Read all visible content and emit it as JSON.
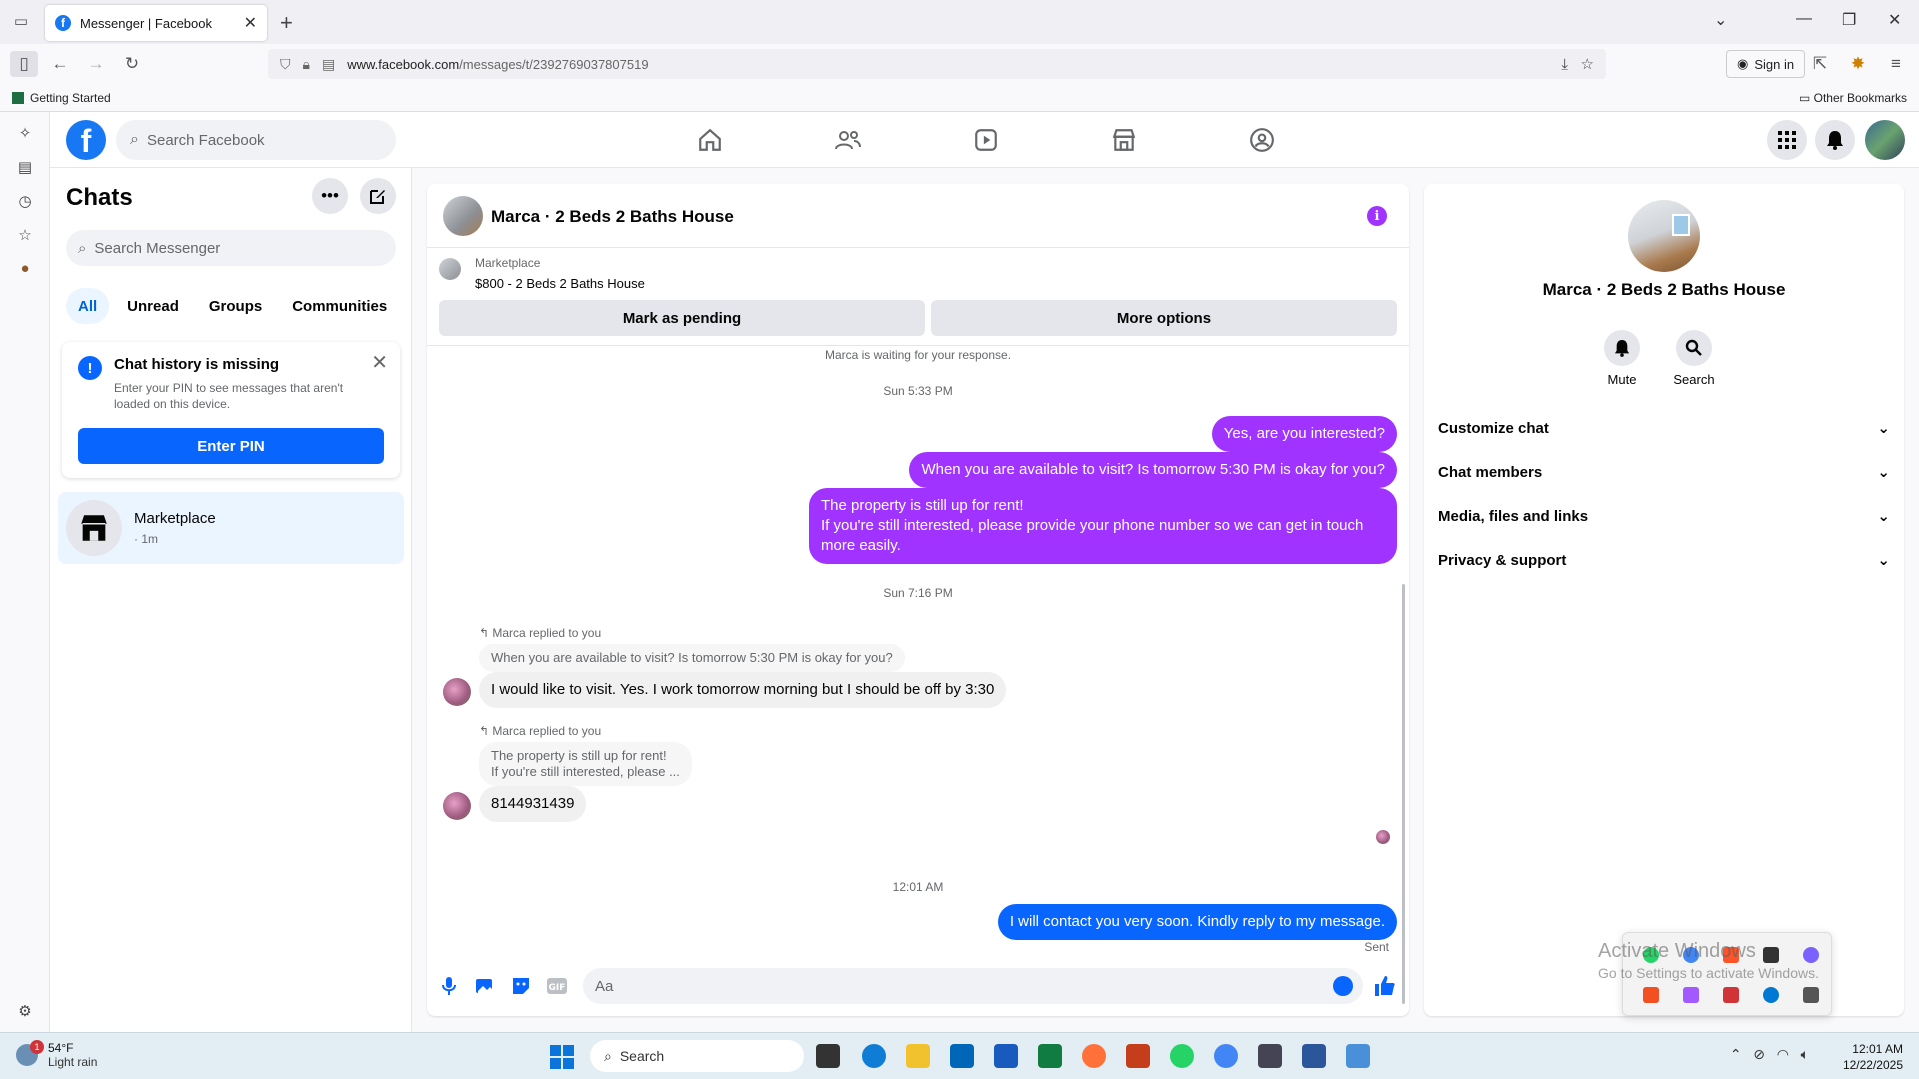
{
  "browser": {
    "tab_title": "Messenger | Facebook",
    "url_domain": "www.facebook.com",
    "url_path": "/messages/t/2392769037807519",
    "sign_in": "Sign in",
    "bookmark_getting_started": "Getting Started",
    "bookmark_other": "Other Bookmarks"
  },
  "header": {
    "search_placeholder": "Search Facebook"
  },
  "chats": {
    "title": "Chats",
    "search_placeholder": "Search Messenger",
    "filters": [
      "All",
      "Unread",
      "Groups",
      "Communities"
    ],
    "missing_title": "Chat history is missing",
    "missing_desc": "Enter your PIN to see messages that aren't loaded on this device.",
    "enter_pin": "Enter PIN",
    "convo_name": "Marketplace",
    "convo_time": "· 1m"
  },
  "conversation": {
    "title": "Marca · 2 Beds 2 Baths House",
    "marketplace_label": "Marketplace",
    "listing": "$800 - 2 Beds 2 Baths House",
    "mark_pending": "Mark as pending",
    "more_options": "More options",
    "waiting_note": "Marca is waiting for your response.",
    "time1": "Sun 5:33 PM",
    "msg1": "Yes, are you interested?",
    "msg2": "When you are available to visit? Is tomorrow 5:30 PM is okay for you?",
    "msg3a": "The property is still up for rent!",
    "msg3b": "If you're still interested, please provide your phone number so we can get in touch more easily.",
    "time2": "Sun 7:16 PM",
    "replied1": "Marca replied to you",
    "quote1": "When you are available to visit? Is tomorrow 5:30 PM is okay for you?",
    "reply1": "I would like to visit. Yes. I work tomorrow morning but I should be off by 3:30",
    "replied2": "Marca replied to you",
    "quote2a": "The property is still up for rent!",
    "quote2b": "If you're still interested, please ...",
    "reply2": "8144931439",
    "time3": "12:01 AM",
    "msg4": "I will contact you very soon. Kindly reply to my message.",
    "status": "Sent",
    "composer_placeholder": "Aa"
  },
  "info_panel": {
    "title": "Marca · 2 Beds 2 Baths House",
    "mute": "Mute",
    "search": "Search",
    "sections": [
      "Customize chat",
      "Chat members",
      "Media, files and links",
      "Privacy & support"
    ]
  },
  "windows": {
    "activate_line1": "Activate Windows",
    "activate_line2": "Go to Settings to activate Windows.",
    "weather_temp": "54°F",
    "weather_desc": "Light rain",
    "weather_badge": "1",
    "taskbar_search": "Search",
    "clock_time": "12:01 AM",
    "clock_date": "12/22/2025"
  },
  "colors": {
    "fb_blue": "#1877f2",
    "bubble_purple": "#a033ff",
    "bubble_blue": "#0866ff"
  }
}
